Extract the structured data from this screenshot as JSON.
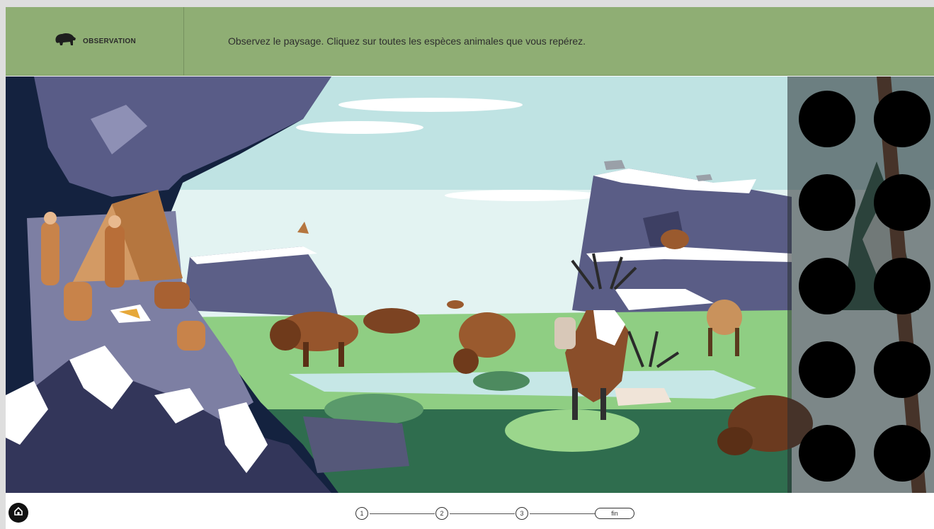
{
  "header": {
    "section_icon": "bison-icon",
    "section_title": "OBSERVATION",
    "instruction": "Observez le paysage. Cliquez sur toutes les espèces animales que vous repérez."
  },
  "scene": {
    "description_icon": "landscape-illustration",
    "answer_slots_count": 10
  },
  "footer": {
    "home_icon": "home-icon",
    "steps": [
      "1",
      "2",
      "3"
    ],
    "finish_label": "fin"
  },
  "colors": {
    "header_bg": "#8fae74",
    "sky": "#dff1f2",
    "rock": "#5c5f87",
    "grass": "#8fcf84",
    "slot": "#000000"
  }
}
